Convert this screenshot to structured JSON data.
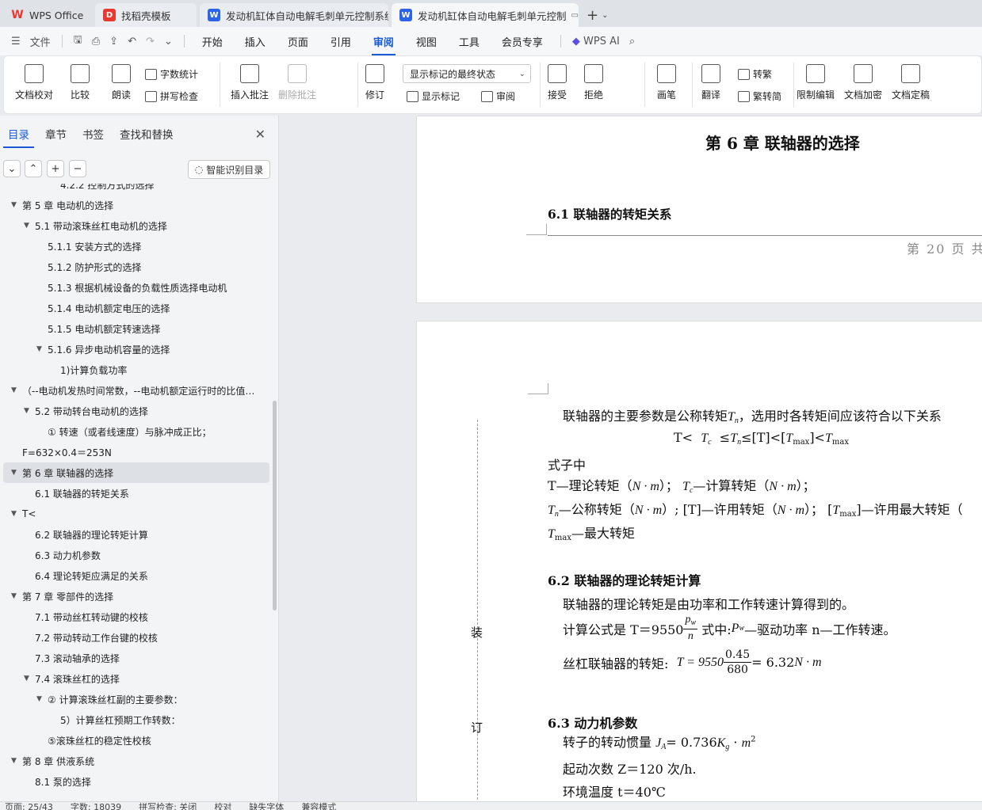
{
  "tabs": [
    {
      "label": "WPS Office",
      "icon": "wps-logo-icon"
    },
    {
      "label": "找稻壳模板",
      "icon": "docer-icon"
    },
    {
      "label": "发动机缸体自动电解毛刺单元控制系统",
      "icon": "word-doc-icon"
    },
    {
      "label": "发动机缸体自动电解毛刺单元控制",
      "icon": "word-doc-icon"
    }
  ],
  "menu": {
    "file": "文件",
    "items": [
      "开始",
      "插入",
      "页面",
      "引用",
      "审阅",
      "视图",
      "工具",
      "会员专享"
    ],
    "active": "审阅",
    "ai": "WPS AI"
  },
  "ribbon": {
    "doc_proof": "文档校对",
    "compare": "比较",
    "read_aloud": "朗读",
    "word_count": "字数统计",
    "spell_check": "拼写检查",
    "insert_comment": "插入批注",
    "delete_comment": "删除批注",
    "revise": "修订",
    "display_mode": "显示标记的最终状态",
    "show_markup": "显示标记",
    "review": "审阅",
    "accept": "接受",
    "reject": "拒绝",
    "pen": "画笔",
    "translate": "翻译",
    "to_traditional": "转繁",
    "to_simplified": "繁转简",
    "restrict_edit": "限制编辑",
    "doc_encrypt": "文档加密",
    "doc_finalize": "文档定稿"
  },
  "nav": {
    "tabs": [
      "目录",
      "章节",
      "书签",
      "查找和替换"
    ],
    "active_tab": "目录",
    "smart_toc": "智能识别目录",
    "toc": [
      {
        "label": "4.2.2 控制方式的选择",
        "level": 4,
        "arrow": false
      },
      {
        "label": "第 5 章  电动机的选择",
        "level": 1,
        "arrow": true
      },
      {
        "label": "5.1  带动滚珠丝杠电动机的选择",
        "level": 2,
        "arrow": true
      },
      {
        "label": "5.1.1  安装方式的选择",
        "level": 3,
        "arrow": false
      },
      {
        "label": "5.1.2  防护形式的选择",
        "level": 3,
        "arrow": false
      },
      {
        "label": "5.1.3  根据机械设备的负载性质选择电动机",
        "level": 3,
        "arrow": false
      },
      {
        "label": "5.1.4  电动机额定电压的选择",
        "level": 3,
        "arrow": false
      },
      {
        "label": "5.1.5  电动机额定转速选择",
        "level": 3,
        "arrow": false
      },
      {
        "label": "5.1.6  异步电动机容量的选择",
        "level": 3,
        "arrow": true
      },
      {
        "label": "1)计算负载功率",
        "level": 4,
        "arrow": false
      },
      {
        "label": "（--电动机发热时间常数，--电动机额定运行时的比值…",
        "level": 1,
        "arrow": true
      },
      {
        "label": "5.2  带动转台电动机的选择",
        "level": 2,
        "arrow": true
      },
      {
        "label": "①  转速（或者线速度）与脉冲成正比；",
        "level": 3,
        "arrow": false
      },
      {
        "label": "F=632×0.4＝253N",
        "level": 0,
        "arrow": false
      },
      {
        "label": "第 6 章  联轴器的选择",
        "level": 1,
        "arrow": true,
        "selected": true
      },
      {
        "label": "6.1 联轴器的转矩关系",
        "level": 2,
        "arrow": false
      },
      {
        "label": "T<",
        "level": 1,
        "arrow": true
      },
      {
        "label": "6.2  联轴器的理论转矩计算",
        "level": 2,
        "arrow": false
      },
      {
        "label": "6.3  动力机参数",
        "level": 2,
        "arrow": false
      },
      {
        "label": "6.4  理论转矩应满足的关系",
        "level": 2,
        "arrow": false
      },
      {
        "label": "第 7 章  零部件的选择",
        "level": 1,
        "arrow": true
      },
      {
        "label": "7.1  带动丝杠转动键的校核",
        "level": 2,
        "arrow": false
      },
      {
        "label": "7.2  带动转动工作台键的校核",
        "level": 2,
        "arrow": false
      },
      {
        "label": "7.3 滚动轴承的选择",
        "level": 2,
        "arrow": false
      },
      {
        "label": "7.4 滚珠丝杠的选择",
        "level": 2,
        "arrow": true
      },
      {
        "label": "②  计算滚珠丝杠副的主要参数：",
        "level": 3,
        "arrow": true
      },
      {
        "label": "5）计算丝杠预期工作转数：",
        "level": 4,
        "arrow": false
      },
      {
        "label": "⑤滚珠丝杠的稳定性校核",
        "level": 3,
        "arrow": false
      },
      {
        "label": "第 8 章  供液系统",
        "level": 1,
        "arrow": true
      },
      {
        "label": "8.1  泵的选择",
        "level": 2,
        "arrow": false
      }
    ]
  },
  "doc": {
    "chapter_title": "第 6 章  联轴器的选择",
    "sec61": "6.1 联轴器的转矩关系",
    "page_footer": "第 20 页 共",
    "para1_a": "联轴器的主要参数是公称转矩",
    "para1_b": "，选用时各转矩间应该符合以下关系",
    "formula1_a": "T<",
    "formula1_b": "≤",
    "formula1_c": "≤[T]<[",
    "formula1_d": "]<",
    "where": "式子中",
    "def1": "T—理论转矩（",
    "def1_b": "）；",
    "def1_c": "—计算转矩（",
    "def1_d": "）；",
    "def2_a": "—公称转矩（",
    "def2_b": "）; [T]—许用转矩（",
    "def2_c": "）；  [",
    "def2_d": "]—许用最大转矩（",
    "def3": "—最大转矩",
    "sec62": "6.2  联轴器的理论转矩计算",
    "p62a": "联轴器的理论转矩是由功率和工作转速计算得到的。",
    "p62b_a": "计算公式是  T＝9550",
    "p62b_b": "式中:",
    "p62b_c": "—驱动功率     n—工作转速。",
    "p62c_a": "丝杠联轴器的转矩:",
    "p62c_b": "T = 9550",
    "p62c_num": "0.45",
    "p62c_den": "680",
    "p62c_c": "= 6.32",
    "sec63": "6.3  动力机参数",
    "p63a_a": "转子的转动惯量",
    "p63a_b": "= 0.736",
    "p63b": "起动次数        Z＝120 次/h.",
    "p63c": "环境温度        t＝40℃",
    "margin_zhuang": "装",
    "margin_ding": "订",
    "units_nm": "N · m",
    "T_c": "T",
    "sub_c": "c",
    "sub_n": "n",
    "sub_max": "max",
    "sub_w": "w",
    "sub_A": "A",
    "sub_g": "g",
    "p_w": "p",
    "n_var": "n",
    "P_w": "P",
    "J_A": "J",
    "K_g": "K",
    "m2": "m",
    "sup2": "2",
    "T": "T"
  },
  "status": {
    "page": "页面: 25/43",
    "words": "字数: 18039",
    "spell": "拼写检查: 关闭",
    "proof": "校对",
    "missing_font": "缺失字体",
    "mode": "兼容模式"
  }
}
